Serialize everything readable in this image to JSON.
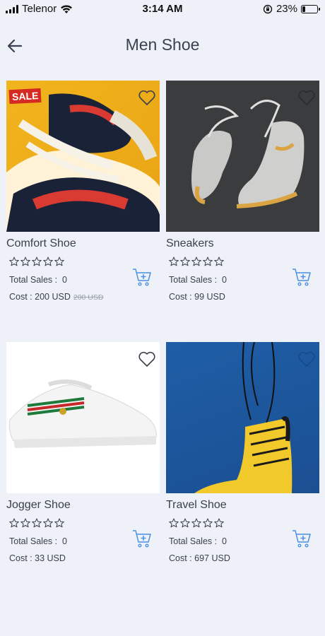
{
  "status_bar": {
    "carrier": "Telenor",
    "time": "3:14 AM",
    "battery_percent": "23%",
    "battery_level": 0.23
  },
  "header": {
    "title": "Men Shoe",
    "back_icon": "back-arrow-icon"
  },
  "labels": {
    "total_sales": "Total Sales :",
    "cost": "Cost :"
  },
  "products": [
    {
      "name": "Comfort Shoe",
      "total_sales": "0",
      "cost": "200 USD",
      "old_cost": "200 USD",
      "badge": "SALE",
      "rating": 0
    },
    {
      "name": "Sneakers",
      "total_sales": "0",
      "cost": "99 USD",
      "rating": 0
    },
    {
      "name": "Jogger Shoe",
      "total_sales": "0",
      "cost": "33 USD",
      "rating": 0
    },
    {
      "name": "Travel Shoe",
      "total_sales": "0",
      "cost": "697 USD",
      "rating": 0
    }
  ],
  "colors": {
    "background": "#eef2f8",
    "accent": "#4a90e2",
    "sale_badge": "#d42a21"
  }
}
